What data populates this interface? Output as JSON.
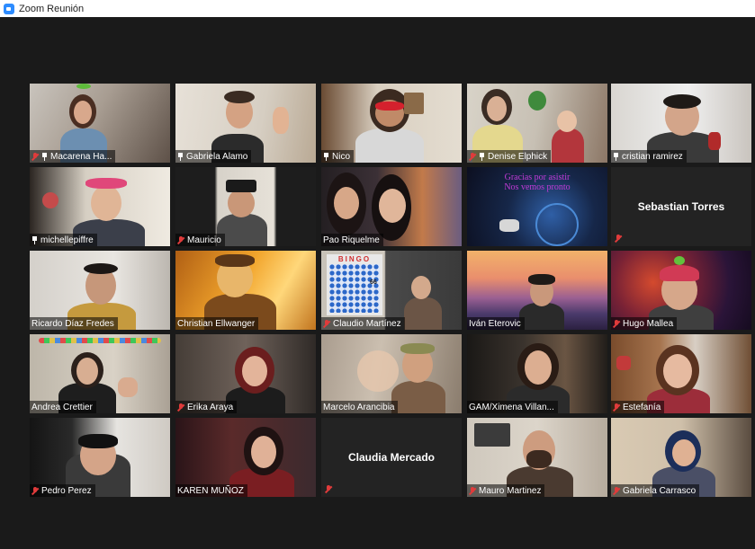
{
  "window": {
    "title": "Zoom Reunión"
  },
  "participants": [
    {
      "name": "Macarena Ha...",
      "muted": true,
      "pinned": true
    },
    {
      "name": "Gabriela Alamo",
      "muted": false,
      "pinned": true
    },
    {
      "name": "Nico",
      "muted": false,
      "pinned": true,
      "active_speaker": true
    },
    {
      "name": "Denise Elphick",
      "muted": true,
      "pinned": true
    },
    {
      "name": "cristian ramirez",
      "muted": false,
      "pinned": true
    },
    {
      "name": "michellepiffre",
      "muted": false,
      "pinned": true
    },
    {
      "name": "Mauricio",
      "muted": true,
      "pinned": false
    },
    {
      "name": "Pao Riquelme",
      "muted": false,
      "pinned": false
    },
    {
      "name": "",
      "muted": false,
      "pinned": false,
      "shared_text": [
        "Gracias por asistir",
        "Nos vemos pronto"
      ]
    },
    {
      "name": "Sebastian Torres",
      "muted": true,
      "pinned": false,
      "camera_off": true
    },
    {
      "name": "Ricardo Díaz Fredes",
      "muted": false,
      "pinned": false
    },
    {
      "name": "Christian Ellwanger",
      "muted": false,
      "pinned": false
    },
    {
      "name": "Claudio Martínez",
      "muted": true,
      "pinned": false,
      "bingo": {
        "title": "BINGO",
        "number": "66"
      }
    },
    {
      "name": "Iván Eterovic",
      "muted": false,
      "pinned": false
    },
    {
      "name": "Hugo Mallea",
      "muted": true,
      "pinned": false
    },
    {
      "name": "Andrea Crettier",
      "muted": false,
      "pinned": false
    },
    {
      "name": "Erika Araya",
      "muted": true,
      "pinned": false
    },
    {
      "name": "Marcelo Arancibia",
      "muted": false,
      "pinned": false
    },
    {
      "name": "GAM/Ximena Villan...",
      "muted": false,
      "pinned": false
    },
    {
      "name": "Estefanía",
      "muted": true,
      "pinned": false
    },
    {
      "name": "Pedro Perez",
      "muted": true,
      "pinned": false
    },
    {
      "name": "KAREN MUÑOZ",
      "muted": false,
      "pinned": false
    },
    {
      "name": "Claudia Mercado",
      "muted": true,
      "pinned": false,
      "camera_off": true
    },
    {
      "name": "Mauro Martinez",
      "muted": true,
      "pinned": false
    },
    {
      "name": "Gabriela Carrasco",
      "muted": true,
      "pinned": false
    }
  ],
  "colors": {
    "background": "#1a1a1a",
    "tile_off": "#232323",
    "active_border": "#c8e62d",
    "muted_red": "#e03b3b"
  }
}
